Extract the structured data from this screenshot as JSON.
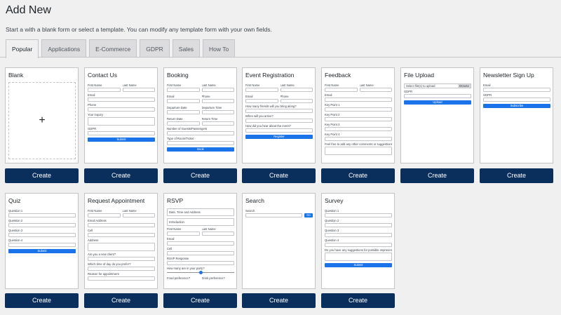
{
  "header": {
    "title": "Add New",
    "subtitle": "Start a with a blank form or select a template. You can modify any template form with your own fields."
  },
  "tabs": [
    "Popular",
    "Applications",
    "E-Commerce",
    "GDPR",
    "Sales",
    "How To"
  ],
  "create_label": "Create",
  "templates": {
    "blank": {
      "title": "Blank",
      "plus": "+"
    },
    "contact": {
      "title": "Contact Us",
      "first": "First Name",
      "last": "Last Name",
      "email": "Email",
      "phone": "Phone",
      "inquiry": "Your inquiry",
      "gdpr": "GDPR",
      "submit": "Submit"
    },
    "booking": {
      "title": "Booking",
      "first": "First Name",
      "last": "Last Name",
      "email": "Email",
      "phone": "Phone",
      "dep_date": "Departure Date",
      "dep_time": "Departure Time",
      "ret_date": "Return Date",
      "ret_time": "Return Time",
      "guests": "Number of Guests/Passengers",
      "room": "Type of Room/Ticket",
      "book": "Book"
    },
    "event": {
      "title": "Event Registration",
      "first": "First Name",
      "last": "Last Name",
      "email": "Email",
      "phone": "Phone",
      "friends": "How many friends will you bring along?",
      "arrive": "When will you arrive?",
      "hear": "How did you hear about the event?",
      "register": "Register"
    },
    "feedback": {
      "title": "Feedback",
      "first": "First Name",
      "last": "Last Name",
      "email": "Email",
      "k1": "Key Point 1",
      "k2": "Key Point 2",
      "k3": "Key Point 3",
      "k4": "Key Point 4",
      "comments": "Feel free to add any other comments or suggestions"
    },
    "upload": {
      "title": "File Upload",
      "select": "Select file(s) to upload",
      "browse": "Browse",
      "gdpr": "GDPR",
      "upload": "Upload"
    },
    "newsletter": {
      "title": "Newsletter Sign Up",
      "email": "Email",
      "gdpr": "GDPR",
      "subscribe": "Subscribe"
    },
    "quiz": {
      "title": "Quiz",
      "q1": "Question 1",
      "q2": "Question 2",
      "q3": "Question 3",
      "q4": "Question 4",
      "submit": "Submit"
    },
    "appointment": {
      "title": "Request Appointment",
      "first": "First Name",
      "last": "Last Name",
      "email": "Email Address",
      "cell": "Cell",
      "address": "Address",
      "new_client": "Are you a new client?",
      "time": "Which time of day do you prefer?",
      "reason": "Reason for appointment"
    },
    "rsvp": {
      "title": "RSVP",
      "datetime": "Date, Time and Address",
      "intro": "Introduction",
      "first": "First Name",
      "last": "Last Name",
      "email": "Email",
      "cell": "Cell",
      "response": "RSVP Response",
      "party": "How many are in your party?",
      "food": "Food preference?",
      "drink": "Drink preference?"
    },
    "search": {
      "title": "Search",
      "label": "Search",
      "go": "Go"
    },
    "survey": {
      "title": "Survey",
      "q1": "Question 1",
      "q2": "Question 2",
      "q3": "Question 3",
      "q4": "Question 4",
      "suggest": "Do you have any suggestions for possible improvements?",
      "submit": "Submit"
    }
  }
}
